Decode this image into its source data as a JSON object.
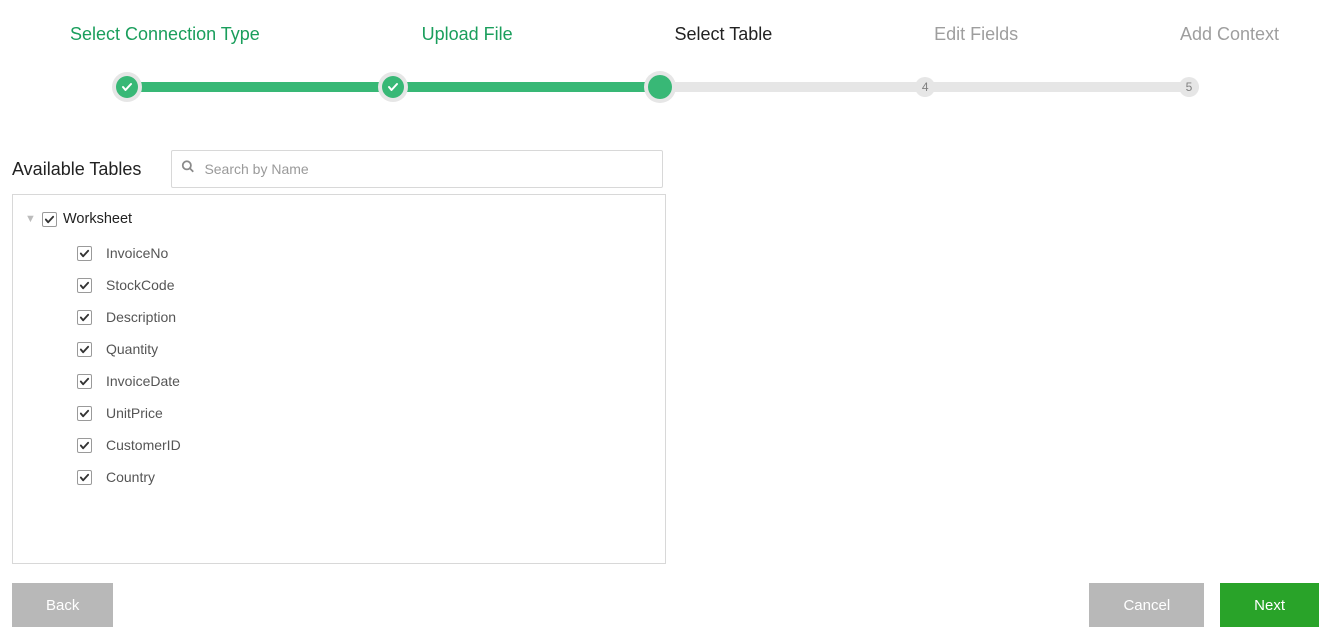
{
  "wizard": {
    "steps": [
      {
        "label": "Select Connection Type",
        "state": "done"
      },
      {
        "label": "Upload File",
        "state": "done"
      },
      {
        "label": "Select Table",
        "state": "current"
      },
      {
        "label": "Edit Fields",
        "state": "future",
        "num": "4"
      },
      {
        "label": "Add Context",
        "state": "future",
        "num": "5"
      }
    ]
  },
  "tables": {
    "title": "Available Tables",
    "search_placeholder": "Search by Name",
    "root": {
      "label": "Worksheet",
      "checked": true,
      "expanded": true
    },
    "columns": [
      {
        "label": "InvoiceNo",
        "checked": true
      },
      {
        "label": "StockCode",
        "checked": true
      },
      {
        "label": "Description",
        "checked": true
      },
      {
        "label": "Quantity",
        "checked": true
      },
      {
        "label": "InvoiceDate",
        "checked": true
      },
      {
        "label": "UnitPrice",
        "checked": true
      },
      {
        "label": "CustomerID",
        "checked": true
      },
      {
        "label": "Country",
        "checked": true
      }
    ]
  },
  "footer": {
    "back": "Back",
    "cancel": "Cancel",
    "next": "Next"
  },
  "colors": {
    "accent_green": "#38b876",
    "button_green": "#29a329",
    "step_done": "#1a9e5c",
    "step_current": "#222222",
    "step_future": "#9e9e9e"
  }
}
